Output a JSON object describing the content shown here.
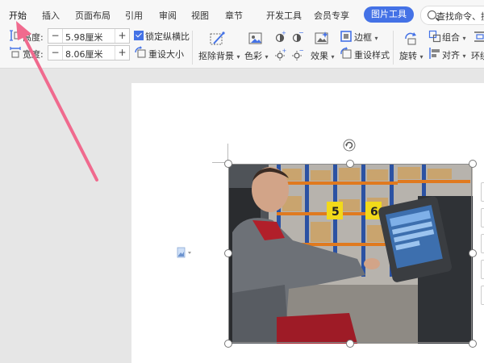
{
  "menu": {
    "tabs": [
      "开始",
      "插入",
      "页面布局",
      "引用",
      "审阅",
      "视图",
      "章节",
      "开发工具",
      "会员专享"
    ],
    "active_tab": "图片工具",
    "search_text": "查找命令、搜"
  },
  "ribbon": {
    "height_label": "高度:",
    "height_value": "5.98厘米",
    "width_label": "宽度:",
    "width_value": "8.06厘米",
    "lock_ratio_label": "锁定纵横比",
    "lock_ratio_checked": true,
    "reset_size_label": "重设大小",
    "remove_bg_label": "抠除背景",
    "color_label": "色彩",
    "effects_label": "效果",
    "border_label": "边框",
    "reset_style_label": "重设样式",
    "rotate_label": "旋转",
    "group_label": "组合",
    "align_label": "对齐",
    "wrap_label": "环绕"
  },
  "colors": {
    "accent": "#4472e6",
    "arrow": "#f06a8e",
    "ribbon_bg": "#f7f7f7",
    "canvas_bg": "#e6e6e6"
  },
  "document": {
    "image_description_icon": "image-icon",
    "image_caption": "Man in red and gray jacket operating a touchscreen terminal on a forklift in a warehouse with shelving numbered 5 and 6",
    "shelf_number_left": "5",
    "shelf_number_right": "6"
  }
}
